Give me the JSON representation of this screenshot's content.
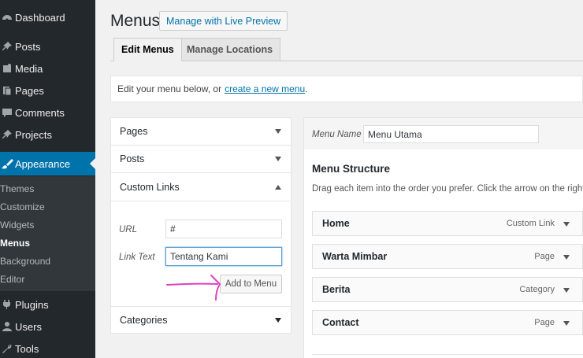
{
  "sidebar": {
    "items": [
      {
        "label": "Dashboard",
        "icon": "dashboard-icon"
      },
      {
        "label": "Posts",
        "icon": "pin-icon"
      },
      {
        "label": "Media",
        "icon": "media-icon"
      },
      {
        "label": "Pages",
        "icon": "pages-icon"
      },
      {
        "label": "Comments",
        "icon": "comments-icon"
      },
      {
        "label": "Projects",
        "icon": "pin-icon"
      },
      {
        "label": "Appearance",
        "icon": "brush-icon"
      },
      {
        "label": "Plugins",
        "icon": "plugin-icon"
      },
      {
        "label": "Users",
        "icon": "users-icon"
      },
      {
        "label": "Tools",
        "icon": "wrench-icon"
      }
    ],
    "submenu": [
      "Themes",
      "Customize",
      "Widgets",
      "Menus",
      "Background",
      "Editor"
    ],
    "accent": "#0073aa"
  },
  "header": {
    "title": "Menus",
    "live_preview": "Manage with Live Preview"
  },
  "tabs": [
    "Edit Menus",
    "Manage Locations"
  ],
  "notice": {
    "text": "Edit your menu below, or",
    "link": "create a new menu",
    "suffix": "."
  },
  "left_panel": {
    "pages": "Pages",
    "posts": "Posts",
    "custom_links": "Custom Links",
    "url_label": "URL",
    "url_value": "#",
    "link_text_label": "Link Text",
    "link_text_value": "Tentang Kami",
    "add_button": "Add to Menu",
    "categories": "Categories"
  },
  "right_panel": {
    "menu_name_label": "Menu Name",
    "menu_name_value": "Menu Utama",
    "structure_title": "Menu Structure",
    "structure_desc": "Drag each item into the order you prefer. Click the arrow on the right of",
    "items": [
      {
        "title": "Home",
        "type": "Custom Link"
      },
      {
        "title": "Warta Mimbar",
        "type": "Page"
      },
      {
        "title": "Berita",
        "type": "Category"
      },
      {
        "title": "Contact",
        "type": "Page"
      }
    ]
  }
}
